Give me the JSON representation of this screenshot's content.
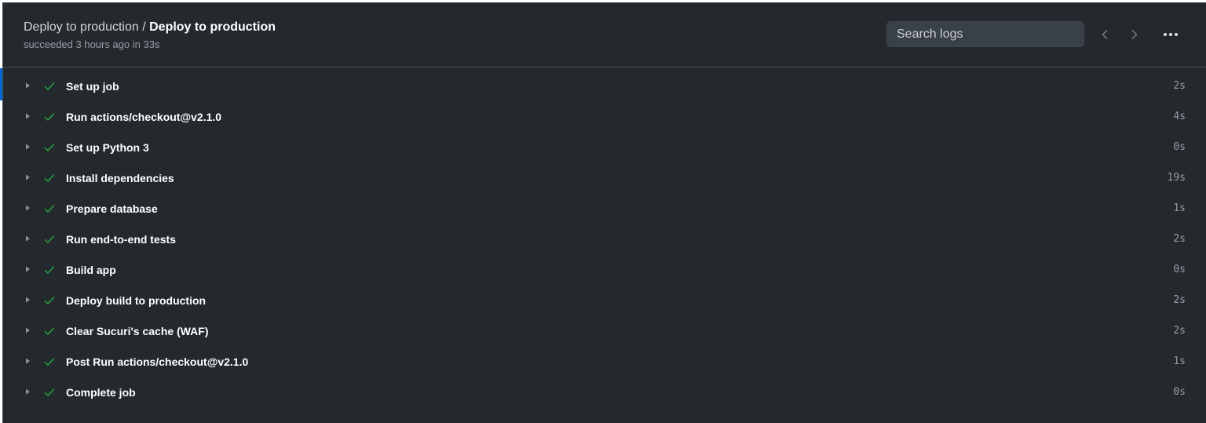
{
  "header": {
    "workflow_name": "Deploy to production",
    "separator": " / ",
    "job_name": "Deploy to production",
    "status_line": "succeeded 3 hours ago in 33s"
  },
  "search": {
    "placeholder": "Search logs"
  },
  "icons": {
    "prev": "chevron-left-icon",
    "next": "chevron-right-icon",
    "more": "kebab-horizontal-icon",
    "expand": "triangle-right-icon",
    "status": "check-icon"
  },
  "colors": {
    "background": "#24292e",
    "border": "#444c56",
    "success": "#28a745",
    "selected_accent": "#0366d6"
  },
  "steps": [
    {
      "name": "Set up job",
      "duration": "2s"
    },
    {
      "name": "Run actions/checkout@v2.1.0",
      "duration": "4s"
    },
    {
      "name": "Set up Python 3",
      "duration": "0s"
    },
    {
      "name": "Install dependencies",
      "duration": "19s"
    },
    {
      "name": "Prepare database",
      "duration": "1s"
    },
    {
      "name": "Run end-to-end tests",
      "duration": "2s"
    },
    {
      "name": "Build app",
      "duration": "0s"
    },
    {
      "name": "Deploy build to production",
      "duration": "2s"
    },
    {
      "name": "Clear Sucuri's cache (WAF)",
      "duration": "2s"
    },
    {
      "name": "Post Run actions/checkout@v2.1.0",
      "duration": "1s"
    },
    {
      "name": "Complete job",
      "duration": "0s"
    }
  ]
}
